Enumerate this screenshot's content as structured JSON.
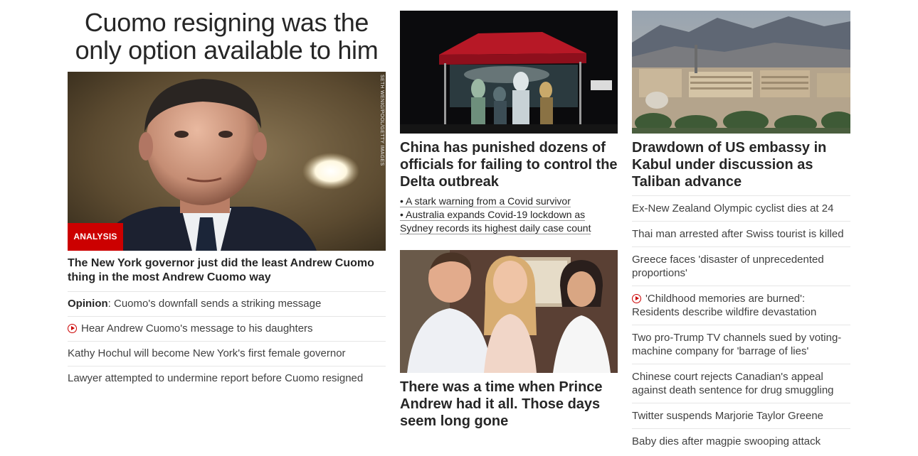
{
  "main": {
    "headline": "Cuomo resigning was the only option available to him",
    "photo_credit": "SETH WENIG/POOL/GETTY IMAGES",
    "badge": "ANALYSIS",
    "subheadline": "The New York governor just did the least Andrew Cuomo thing in the most Andrew Cuomo way",
    "links": [
      {
        "prefix": "Opinion",
        "text": ": Cuomo's downfall sends a striking message"
      },
      {
        "video": true,
        "text": "Hear Andrew Cuomo's message to his daughters"
      },
      {
        "text": "Kathy Hochul will become New York's first female governor"
      },
      {
        "text": "Lawyer attempted to undermine report before Cuomo resigned"
      }
    ]
  },
  "middle": {
    "story1": {
      "headline": "China has punished dozens of officials for failing to control the Delta outbreak",
      "bullets": [
        "• A stark warning from a Covid survivor",
        "• Australia expands Covid-19 lockdown as Sydney records its highest daily case count"
      ]
    },
    "story2": {
      "headline": "There was a time when Prince Andrew had it all. Those days seem long gone"
    }
  },
  "right": {
    "headline": "Drawdown of US embassy in Kabul under discussion as Taliban advance",
    "links": [
      {
        "text": "Ex-New Zealand Olympic cyclist dies at 24"
      },
      {
        "text": "Thai man arrested after Swiss tourist is killed"
      },
      {
        "text": "Greece faces 'disaster of unprecedented proportions'"
      },
      {
        "video": true,
        "text": "'Childhood memories are burned': Residents describe wildfire devastation"
      },
      {
        "text": "Two pro-Trump TV channels sued by voting-machine company for 'barrage of lies'"
      },
      {
        "text": "Chinese court rejects Canadian's appeal against death sentence for drug smuggling"
      },
      {
        "text": "Twitter suspends Marjorie Taylor Greene"
      },
      {
        "text": "Baby dies after magpie swooping attack"
      }
    ]
  },
  "colors": {
    "accent_red": "#cc0000",
    "text_dark": "#262626",
    "divider": "#e6e6e6"
  },
  "icons": {
    "video": "play-circle-icon"
  }
}
